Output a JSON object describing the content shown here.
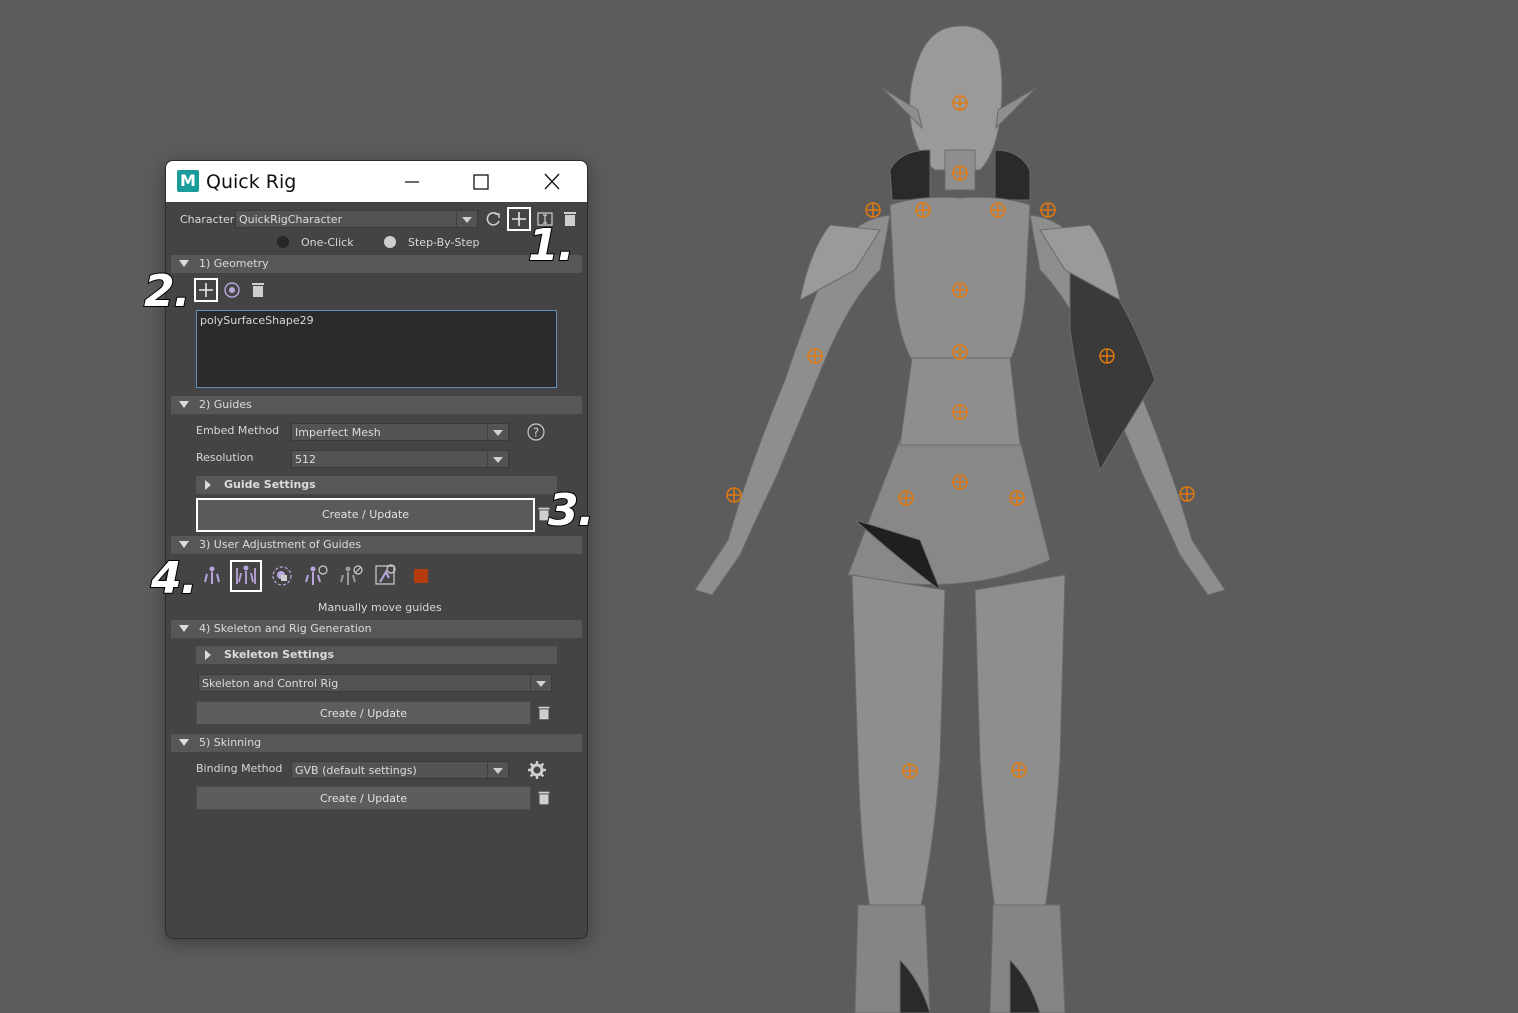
{
  "window": {
    "app_logo": "M",
    "title": "Quick Rig"
  },
  "character": {
    "label": "Character:",
    "value": "QuickRigCharacter",
    "modes": [
      "One-Click",
      "Step-By-Step"
    ],
    "selected_mode": "Step-By-Step"
  },
  "geometry": {
    "header": "1) Geometry",
    "items": [
      "polySurfaceShape29"
    ]
  },
  "guides": {
    "header": "2) Guides",
    "embed_label": "Embed Method",
    "embed_value": "Imperfect Mesh",
    "resolution_label": "Resolution",
    "resolution_value": "512",
    "settings_label": "Guide Settings",
    "create_label": "Create / Update"
  },
  "adjust": {
    "header": "3) User Adjustment of Guides",
    "status": "Manually move guides",
    "color_swatch": "#b83a10"
  },
  "skeleton": {
    "header": "4) Skeleton and Rig Generation",
    "settings_label": "Skeleton Settings",
    "type_value": "Skeleton and Control Rig",
    "create_label": "Create / Update"
  },
  "skinning": {
    "header": "5) Skinning",
    "binding_label": "Binding Method",
    "binding_value": "GVB (default settings)",
    "create_label": "Create / Update"
  },
  "step_markers": {
    "one": "1.",
    "two": "2.",
    "three": "3.",
    "four": "4."
  },
  "colors": {
    "guide_marker": "#e07a10",
    "highlight": "#ffffff",
    "viewport_bg": "#5c5c5c"
  }
}
